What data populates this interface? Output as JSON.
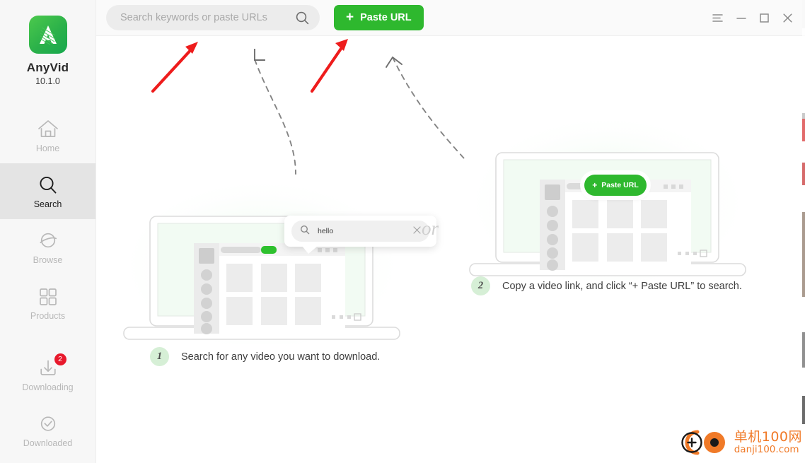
{
  "sidebar": {
    "brand_name": "AnyVid",
    "version": "10.1.0",
    "items": [
      {
        "label": "Home",
        "icon": "home-icon",
        "active": false,
        "badge": null
      },
      {
        "label": "Search",
        "icon": "search-icon",
        "active": true,
        "badge": null
      },
      {
        "label": "Browse",
        "icon": "globe-icon",
        "active": false,
        "badge": null
      },
      {
        "label": "Products",
        "icon": "grid-icon",
        "active": false,
        "badge": null
      },
      {
        "label": "Downloading",
        "icon": "download-icon",
        "active": false,
        "badge": "2"
      },
      {
        "label": "Downloaded",
        "icon": "check-circle-icon",
        "active": false,
        "badge": null
      }
    ]
  },
  "topbar": {
    "search_placeholder": "Search keywords or paste URLs",
    "search_value": "",
    "search_icon": "search-icon",
    "paste_button_label": "Paste URL",
    "paste_button_plus": "+",
    "window_controls": [
      {
        "name": "menu-icon",
        "glyph": "menu"
      },
      {
        "name": "minimize-icon",
        "glyph": "minimize"
      },
      {
        "name": "maximize-icon",
        "glyph": "maximize"
      },
      {
        "name": "close-icon",
        "glyph": "close"
      }
    ]
  },
  "main": {
    "divider_text": "or",
    "step_one": {
      "number": "1",
      "text": "Search for any video you want to download.",
      "popup_query": "hello",
      "popup_search_icon": "search-icon",
      "popup_clear_icon": "close-icon"
    },
    "step_two": {
      "number": "2",
      "text": "Copy a video link, and click “+ Paste URL” to search.",
      "bubble_label": "Paste URL",
      "bubble_plus": "+"
    }
  },
  "watermark": {
    "cn_text": "单机100网",
    "en_text": "danji100.com"
  },
  "colors": {
    "brand_green": "#2eb82e",
    "badge_red": "#e8192c",
    "arrow_red": "#ee1c1c",
    "sidebar_bg": "#f7f7f7",
    "active_bg": "#e4e4e4",
    "accent_light_green": "#d6efd6"
  }
}
